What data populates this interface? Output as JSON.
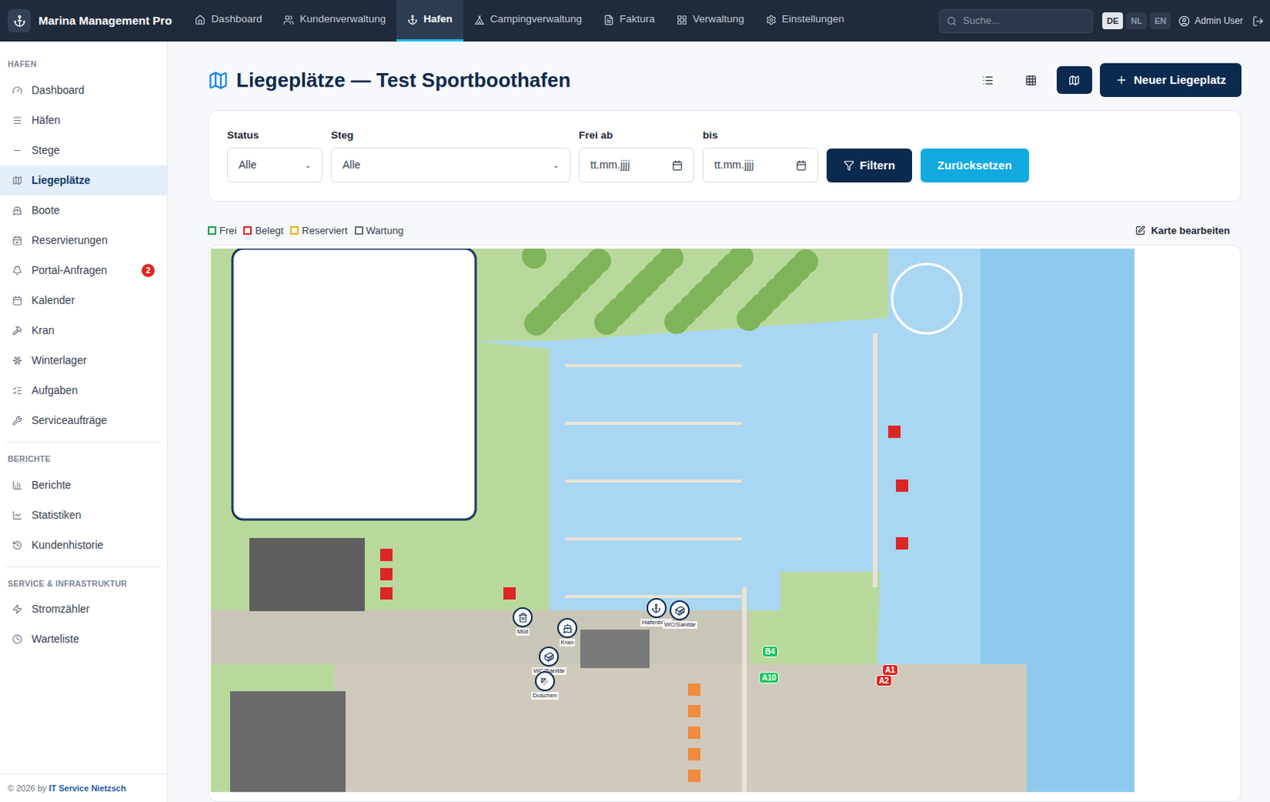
{
  "app": {
    "brand": "Marina Management Pro"
  },
  "nav": [
    {
      "label": "Dashboard",
      "selected": false
    },
    {
      "label": "Kundenverwaltung",
      "selected": false
    },
    {
      "label": "Hafen",
      "selected": true
    },
    {
      "label": "Campingverwaltung",
      "selected": false
    },
    {
      "label": "Faktura",
      "selected": false
    },
    {
      "label": "Verwaltung",
      "selected": false
    },
    {
      "label": "Einstellungen",
      "selected": false
    }
  ],
  "search": {
    "placeholder": "Suche..."
  },
  "languages": [
    {
      "label": "DE",
      "selected": true
    },
    {
      "label": "NL",
      "selected": false
    },
    {
      "label": "EN",
      "selected": false
    }
  ],
  "user": "Admin User",
  "sidebar": {
    "sections": [
      {
        "title": "HAFEN",
        "items": [
          {
            "label": "Dashboard",
            "selected": false
          },
          {
            "label": "Häfen",
            "selected": false
          },
          {
            "label": "Stege",
            "selected": false
          },
          {
            "label": "Liegeplätze",
            "selected": true
          },
          {
            "label": "Boote",
            "selected": false
          },
          {
            "label": "Reservierungen",
            "selected": false
          },
          {
            "label": "Portal-Anfragen",
            "selected": false,
            "badge": "2"
          },
          {
            "label": "Kalender",
            "selected": false
          },
          {
            "label": "Kran",
            "selected": false
          },
          {
            "label": "Winterlager",
            "selected": false
          },
          {
            "label": "Aufgaben",
            "selected": false
          },
          {
            "label": "Serviceaufträge",
            "selected": false
          }
        ]
      },
      {
        "title": "BERICHTE",
        "items": [
          {
            "label": "Berichte",
            "selected": false
          },
          {
            "label": "Statistiken",
            "selected": false
          },
          {
            "label": "Kundenhistorie",
            "selected": false
          }
        ]
      },
      {
        "title": "SERVICE & INFRASTRUKTUR",
        "items": [
          {
            "label": "Stromzähler",
            "selected": false
          },
          {
            "label": "Warteliste",
            "selected": false
          }
        ]
      }
    ],
    "footer": {
      "prefix": "© 2026 by",
      "link": "IT Service Nietzsch"
    }
  },
  "page": {
    "title": "Liegeplätze — Test Sportboothafen",
    "view_modes": [
      {
        "kind": "list",
        "selected": false
      },
      {
        "kind": "grid",
        "selected": false
      },
      {
        "kind": "map",
        "selected": true
      }
    ],
    "new_button": "Neuer Liegeplatz"
  },
  "filters": {
    "fields": [
      {
        "label": "Status",
        "value": "Alle",
        "kind": "select"
      },
      {
        "label": "Steg",
        "value": "Alle",
        "kind": "select"
      },
      {
        "label": "Frei ab",
        "value": "tt.mm.jjjj",
        "kind": "date"
      },
      {
        "label": "bis",
        "value": "tt.mm.jjjj",
        "kind": "date"
      }
    ],
    "apply": "Filtern",
    "reset": "Zurücksetzen"
  },
  "legend": [
    {
      "label": "Frei",
      "color": "#16a34a"
    },
    {
      "label": "Belegt",
      "color": "#dc2626"
    },
    {
      "label": "Reserviert",
      "color": "#eab308"
    },
    {
      "label": "Wartung",
      "color": "#6b7280"
    }
  ],
  "edit_map": "Karte bearbeiten",
  "map": {
    "facilities": [
      {
        "label": "Müll",
        "kind": "trash"
      },
      {
        "label": "Kran",
        "kind": "crane"
      },
      {
        "label": "WC/Sanitär",
        "kind": "wc"
      },
      {
        "label": "Duschen",
        "kind": "shower"
      },
      {
        "label": "Hafenbüro",
        "kind": "office"
      },
      {
        "label": "WC/Sanitär",
        "kind": "wc"
      }
    ],
    "berths": [
      {
        "label": "B4",
        "color": "#22c55e"
      },
      {
        "label": "A10",
        "color": "#22c55e"
      },
      {
        "label": "A1",
        "color": "#dc2626"
      },
      {
        "label": "A2",
        "color": "#dc2626"
      }
    ]
  }
}
